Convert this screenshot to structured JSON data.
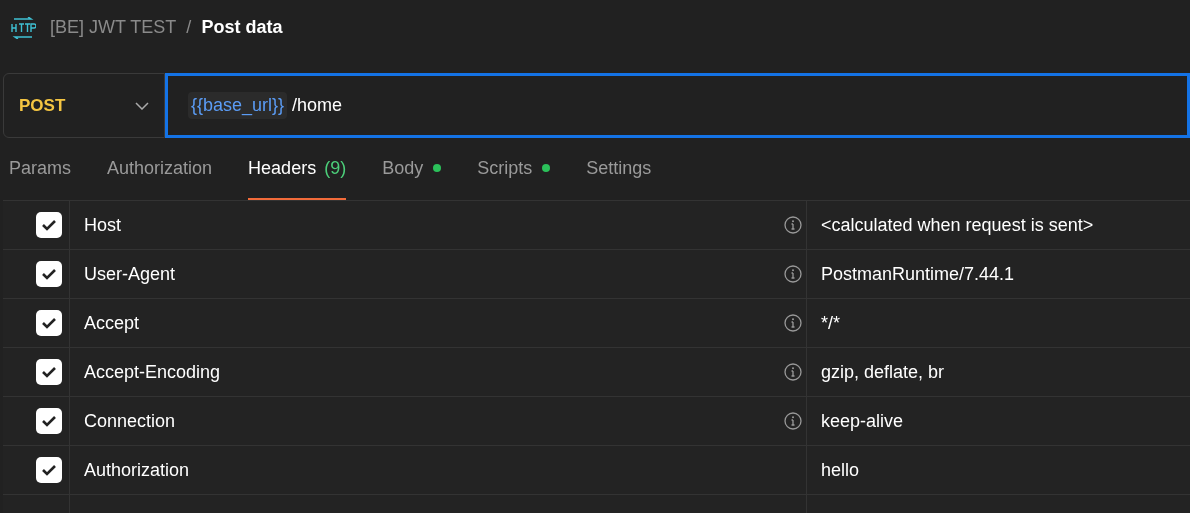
{
  "breadcrumb": {
    "collection": "[BE] JWT TEST",
    "separator": "/",
    "request": "Post data"
  },
  "request": {
    "method": "POST",
    "variable": "{{base_url}}",
    "path": "/home"
  },
  "tabs": [
    {
      "label": "Params",
      "selected": false,
      "dot": false
    },
    {
      "label": "Authorization",
      "selected": false,
      "dot": false
    },
    {
      "label": "Headers",
      "count": "(9)",
      "selected": true,
      "dot": false
    },
    {
      "label": "Body",
      "selected": false,
      "dot": true
    },
    {
      "label": "Scripts",
      "selected": false,
      "dot": true
    },
    {
      "label": "Settings",
      "selected": false,
      "dot": false
    }
  ],
  "headers": [
    {
      "checked": true,
      "key": "Host",
      "info": true,
      "value": "<calculated when request is sent>"
    },
    {
      "checked": true,
      "key": "User-Agent",
      "info": true,
      "value": "PostmanRuntime/7.44.1"
    },
    {
      "checked": true,
      "key": "Accept",
      "info": true,
      "value": "*/*"
    },
    {
      "checked": true,
      "key": "Accept-Encoding",
      "info": true,
      "value": "gzip, deflate, br"
    },
    {
      "checked": true,
      "key": "Connection",
      "info": true,
      "value": "keep-alive"
    },
    {
      "checked": true,
      "key": "Authorization",
      "info": false,
      "value": "hello"
    }
  ]
}
